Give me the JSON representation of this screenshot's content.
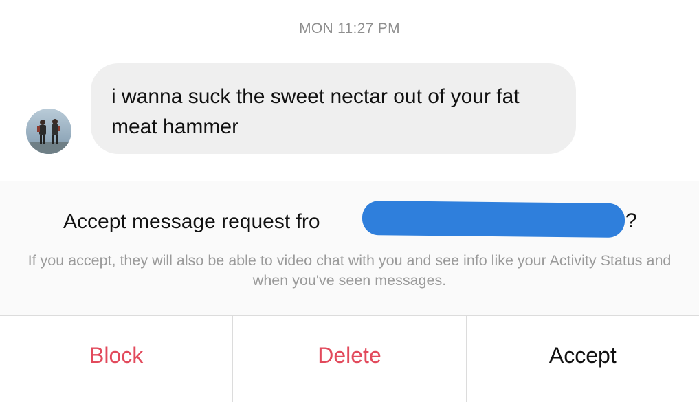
{
  "timestamp": "MON 11:27 PM",
  "message": {
    "text": "i wanna suck the sweet nectar out of your fat meat hammer"
  },
  "request": {
    "title_prefix": "Accept message request fro",
    "title_suffix": "?",
    "description": "If you accept, they will also be able to video chat with you and see info like your Activity Status and when you've seen messages."
  },
  "actions": {
    "block": "Block",
    "delete": "Delete",
    "accept": "Accept"
  },
  "colors": {
    "danger": "#e24a5c",
    "redaction": "#2f7fdc",
    "bubble": "#efefef"
  }
}
